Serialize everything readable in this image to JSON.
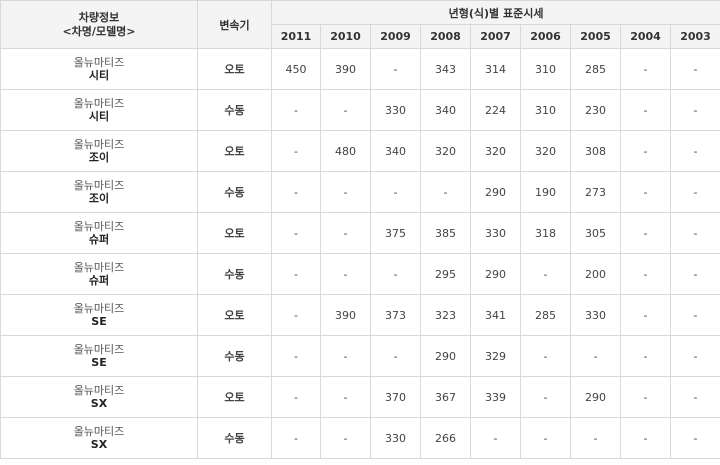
{
  "header": {
    "vehicle_info_line1": "차량정보",
    "vehicle_info_line2": "<차명/모델명>",
    "transmission": "변속기",
    "price_group": "년형(식)별 표준시세",
    "years": [
      "2011",
      "2010",
      "2009",
      "2008",
      "2007",
      "2006",
      "2005",
      "2004",
      "2003"
    ]
  },
  "rows": [
    {
      "model": "올뉴마티즈",
      "sub": "시티",
      "trans": "오토",
      "prices": [
        "450",
        "390",
        "-",
        "343",
        "314",
        "310",
        "285",
        "-",
        "-"
      ]
    },
    {
      "model": "올뉴마티즈",
      "sub": "시티",
      "trans": "수동",
      "prices": [
        "-",
        "-",
        "330",
        "340",
        "224",
        "310",
        "230",
        "-",
        "-"
      ]
    },
    {
      "model": "올뉴마티즈",
      "sub": "조이",
      "trans": "오토",
      "prices": [
        "-",
        "480",
        "340",
        "320",
        "320",
        "320",
        "308",
        "-",
        "-"
      ]
    },
    {
      "model": "올뉴마티즈",
      "sub": "조이",
      "trans": "수동",
      "prices": [
        "-",
        "-",
        "-",
        "-",
        "290",
        "190",
        "273",
        "-",
        "-"
      ]
    },
    {
      "model": "올뉴마티즈",
      "sub": "슈퍼",
      "trans": "오토",
      "prices": [
        "-",
        "-",
        "375",
        "385",
        "330",
        "318",
        "305",
        "-",
        "-"
      ]
    },
    {
      "model": "올뉴마티즈",
      "sub": "슈퍼",
      "trans": "수동",
      "prices": [
        "-",
        "-",
        "-",
        "295",
        "290",
        "-",
        "200",
        "-",
        "-"
      ]
    },
    {
      "model": "올뉴마티즈",
      "sub": "SE",
      "trans": "오토",
      "prices": [
        "-",
        "390",
        "373",
        "323",
        "341",
        "285",
        "330",
        "-",
        "-"
      ]
    },
    {
      "model": "올뉴마티즈",
      "sub": "SE",
      "trans": "수동",
      "prices": [
        "-",
        "-",
        "-",
        "290",
        "329",
        "-",
        "-",
        "-",
        "-"
      ]
    },
    {
      "model": "올뉴마티즈",
      "sub": "SX",
      "trans": "오토",
      "prices": [
        "-",
        "-",
        "370",
        "367",
        "339",
        "-",
        "290",
        "-",
        "-"
      ]
    },
    {
      "model": "올뉴마티즈",
      "sub": "SX",
      "trans": "수동",
      "prices": [
        "-",
        "-",
        "330",
        "266",
        "-",
        "-",
        "-",
        "-",
        "-"
      ]
    }
  ]
}
